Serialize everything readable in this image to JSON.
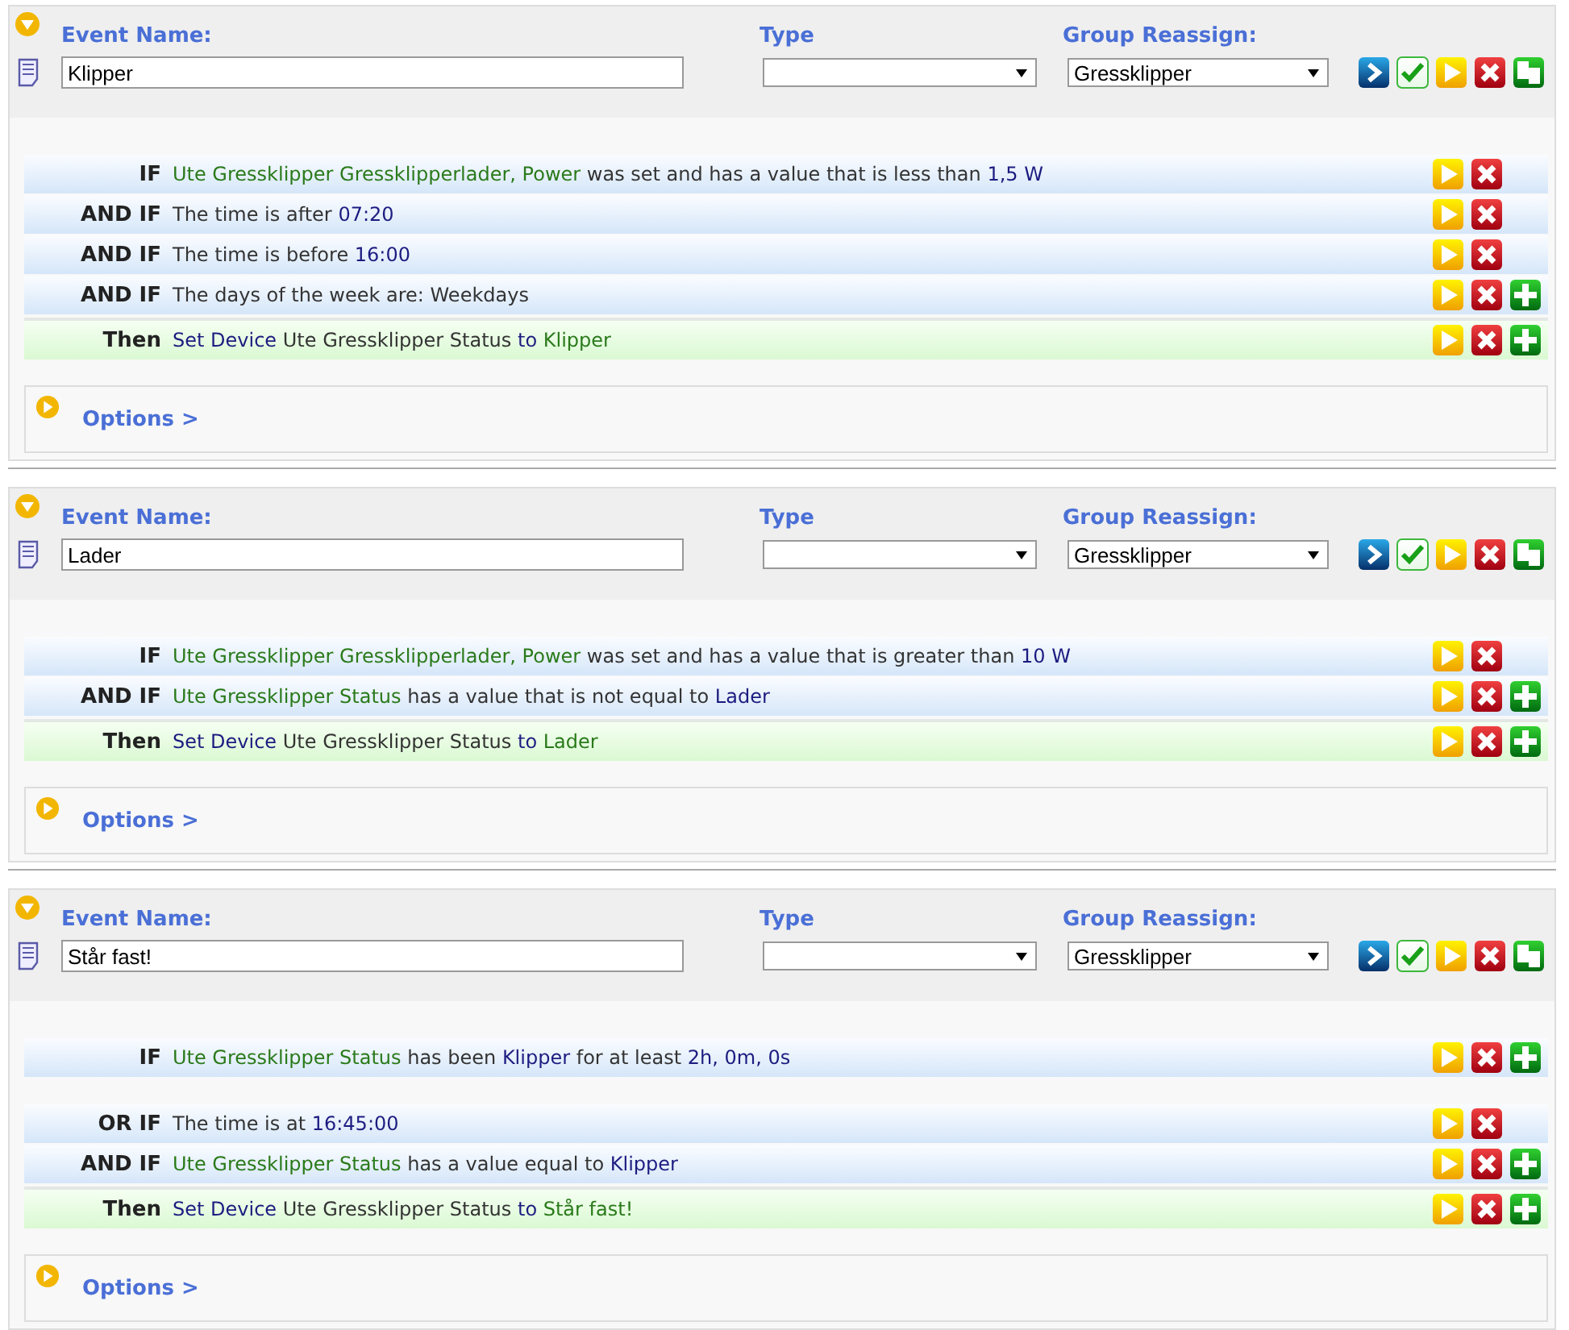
{
  "events": [
    {
      "expanded": true,
      "name_label": "Event Name:",
      "name": "Klipper",
      "type_label": "Type",
      "group_label": "Group Reassign:",
      "group": "Gressklipper",
      "actions": [
        {
          "kind": "go"
        },
        {
          "kind": "save"
        },
        {
          "kind": "play"
        },
        {
          "kind": "delete"
        },
        {
          "kind": "copy"
        }
      ],
      "blocks": [
        {
          "rows": [
            {
              "kind": "condition",
              "keyword": "IF",
              "parts": [
                {
                  "kind": "device",
                  "text": "Ute Gressklipper Gressklipperlader, Power"
                },
                {
                  "kind": "text",
                  "text": "was set and has a value that is less than"
                },
                {
                  "kind": "value",
                  "text": "1,5 W"
                }
              ],
              "buttons": [
                {
                  "kind": "play"
                },
                {
                  "kind": "delete"
                }
              ]
            },
            {
              "kind": "condition",
              "keyword": "AND IF",
              "parts": [
                {
                  "kind": "text",
                  "text": "The time is after"
                },
                {
                  "kind": "value",
                  "text": "07:20"
                }
              ],
              "buttons": [
                {
                  "kind": "play"
                },
                {
                  "kind": "delete"
                }
              ]
            },
            {
              "kind": "condition",
              "keyword": "AND IF",
              "parts": [
                {
                  "kind": "text",
                  "text": "The time is before"
                },
                {
                  "kind": "value",
                  "text": "16:00"
                }
              ],
              "buttons": [
                {
                  "kind": "play"
                },
                {
                  "kind": "delete"
                }
              ]
            },
            {
              "kind": "condition",
              "keyword": "AND IF",
              "parts": [
                {
                  "kind": "text",
                  "text": "The days of the week are: Weekdays"
                }
              ],
              "buttons": [
                {
                  "kind": "play"
                },
                {
                  "kind": "delete"
                },
                {
                  "kind": "add"
                }
              ]
            },
            {
              "kind": "action",
              "keyword": "Then",
              "parts": [
                {
                  "kind": "value",
                  "text": "Set Device"
                },
                {
                  "kind": "text",
                  "text": "Ute Gressklipper Status"
                },
                {
                  "kind": "value",
                  "text": "to"
                },
                {
                  "kind": "device",
                  "text": "Klipper"
                }
              ],
              "buttons": [
                {
                  "kind": "play"
                },
                {
                  "kind": "delete"
                },
                {
                  "kind": "add"
                }
              ]
            }
          ]
        }
      ],
      "options": "Options >"
    },
    {
      "expanded": true,
      "name_label": "Event Name:",
      "name": "Lader",
      "type_label": "Type",
      "group_label": "Group Reassign:",
      "group": "Gressklipper",
      "actions": [
        {
          "kind": "go"
        },
        {
          "kind": "save"
        },
        {
          "kind": "play"
        },
        {
          "kind": "delete"
        },
        {
          "kind": "copy"
        }
      ],
      "blocks": [
        {
          "rows": [
            {
              "kind": "condition",
              "keyword": "IF",
              "parts": [
                {
                  "kind": "device",
                  "text": "Ute Gressklipper Gressklipperlader, Power"
                },
                {
                  "kind": "text",
                  "text": "was set and has a value that is greater than"
                },
                {
                  "kind": "value",
                  "text": "10 W"
                }
              ],
              "buttons": [
                {
                  "kind": "play"
                },
                {
                  "kind": "delete"
                }
              ]
            },
            {
              "kind": "condition",
              "keyword": "AND IF",
              "parts": [
                {
                  "kind": "device",
                  "text": "Ute Gressklipper Status"
                },
                {
                  "kind": "text",
                  "text": "has a value that is not equal to"
                },
                {
                  "kind": "value",
                  "text": "Lader"
                }
              ],
              "buttons": [
                {
                  "kind": "play"
                },
                {
                  "kind": "delete"
                },
                {
                  "kind": "add"
                }
              ]
            },
            {
              "kind": "action",
              "keyword": "Then",
              "parts": [
                {
                  "kind": "value",
                  "text": "Set Device"
                },
                {
                  "kind": "text",
                  "text": "Ute Gressklipper Status"
                },
                {
                  "kind": "value",
                  "text": "to"
                },
                {
                  "kind": "device",
                  "text": "Lader"
                }
              ],
              "buttons": [
                {
                  "kind": "play"
                },
                {
                  "kind": "delete"
                },
                {
                  "kind": "add"
                }
              ]
            }
          ]
        }
      ],
      "options": "Options >"
    },
    {
      "expanded": true,
      "name_label": "Event Name:",
      "name": "Står fast!",
      "type_label": "Type",
      "group_label": "Group Reassign:",
      "group": "Gressklipper",
      "actions": [
        {
          "kind": "go"
        },
        {
          "kind": "save"
        },
        {
          "kind": "play"
        },
        {
          "kind": "delete"
        },
        {
          "kind": "copy"
        }
      ],
      "blocks": [
        {
          "rows": [
            {
              "kind": "condition",
              "keyword": "IF",
              "parts": [
                {
                  "kind": "device",
                  "text": "Ute Gressklipper Status"
                },
                {
                  "kind": "text",
                  "text": "has been"
                },
                {
                  "kind": "value",
                  "text": "Klipper"
                },
                {
                  "kind": "text",
                  "text": "for at least"
                },
                {
                  "kind": "value",
                  "text": "2h, 0m, 0s"
                }
              ],
              "buttons": [
                {
                  "kind": "play"
                },
                {
                  "kind": "delete"
                },
                {
                  "kind": "add"
                }
              ]
            }
          ]
        },
        {
          "rows": [
            {
              "kind": "condition",
              "keyword": "OR IF",
              "parts": [
                {
                  "kind": "text",
                  "text": "The time is at"
                },
                {
                  "kind": "value",
                  "text": "16:45:00"
                }
              ],
              "buttons": [
                {
                  "kind": "play"
                },
                {
                  "kind": "delete"
                }
              ]
            },
            {
              "kind": "condition",
              "keyword": "AND IF",
              "parts": [
                {
                  "kind": "device",
                  "text": "Ute Gressklipper Status"
                },
                {
                  "kind": "text",
                  "text": "has a value equal to"
                },
                {
                  "kind": "value",
                  "text": "Klipper"
                }
              ],
              "buttons": [
                {
                  "kind": "play"
                },
                {
                  "kind": "delete"
                },
                {
                  "kind": "add"
                }
              ]
            },
            {
              "kind": "action",
              "keyword": "Then",
              "parts": [
                {
                  "kind": "value",
                  "text": "Set Device"
                },
                {
                  "kind": "text",
                  "text": "Ute Gressklipper Status"
                },
                {
                  "kind": "value",
                  "text": "to"
                },
                {
                  "kind": "device",
                  "text": "Står fast!"
                }
              ],
              "buttons": [
                {
                  "kind": "play"
                },
                {
                  "kind": "delete"
                },
                {
                  "kind": "add"
                }
              ]
            }
          ]
        }
      ],
      "options": "Options >"
    }
  ]
}
